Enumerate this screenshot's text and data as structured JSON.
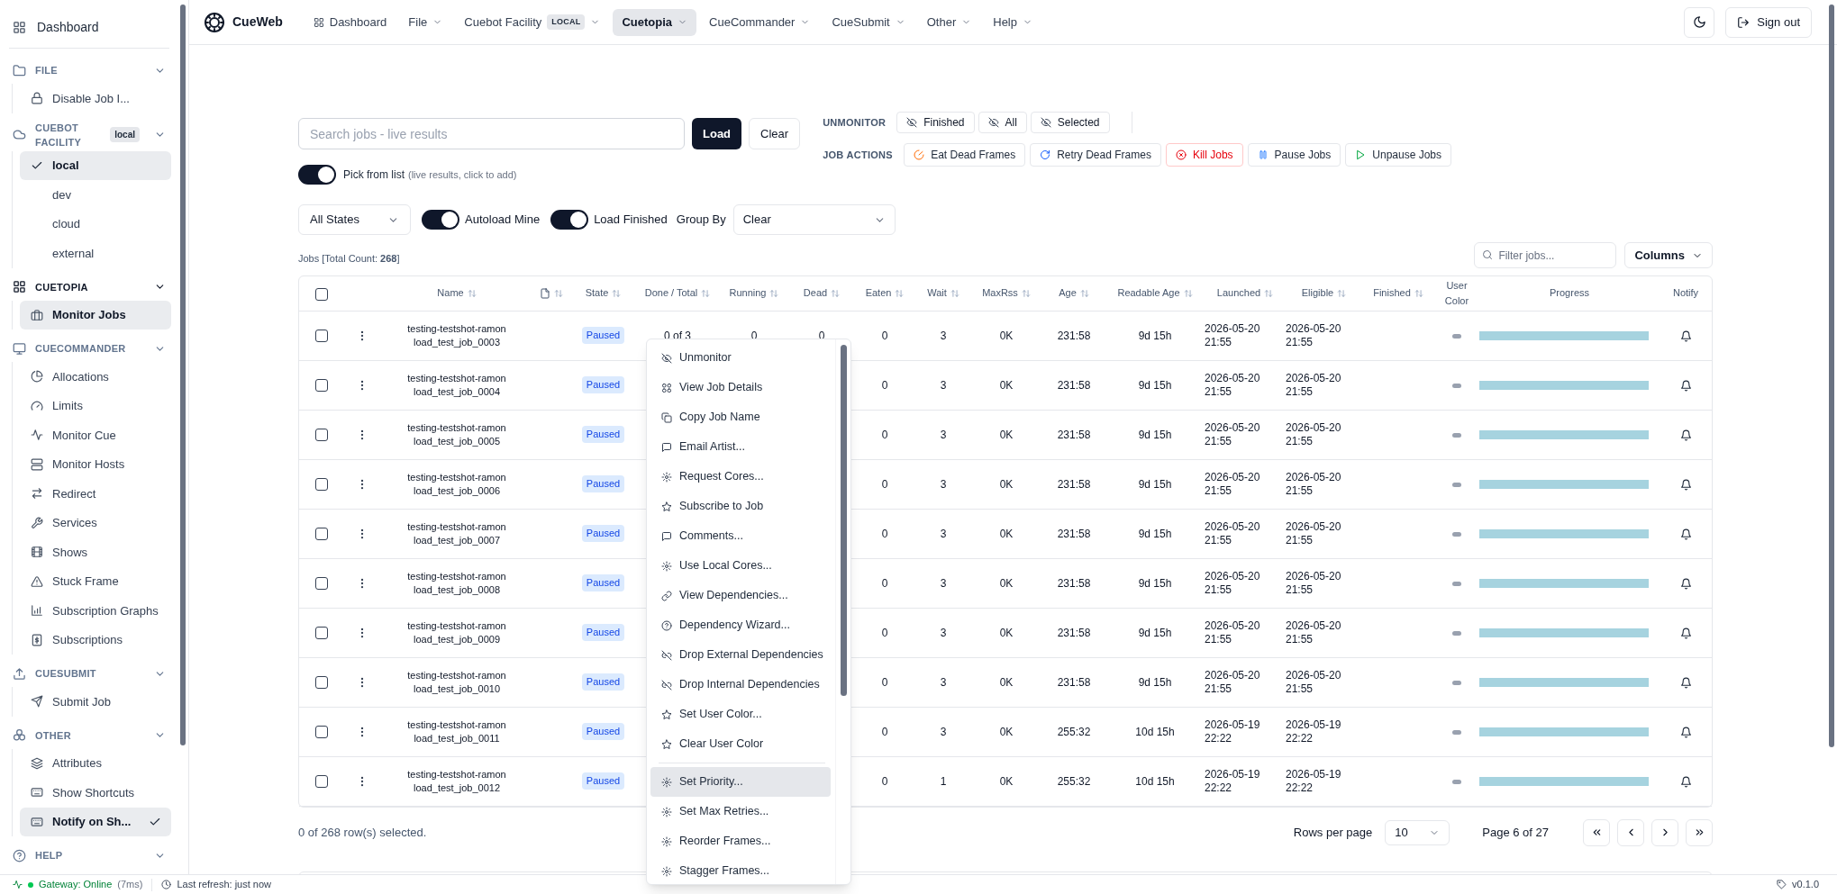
{
  "sidebar": {
    "dashboard": "Dashboard",
    "sections": [
      {
        "title": "FILE",
        "active": false,
        "items": [
          {
            "label": "Disable Job I...",
            "kind": "nav",
            "selected": false
          }
        ]
      },
      {
        "title": "CUEBOT FACILITY",
        "badge": "local",
        "active": false,
        "items": [
          {
            "label": "local",
            "kind": "radio",
            "selected": true,
            "checked": true
          },
          {
            "label": "dev",
            "kind": "radio",
            "selected": false,
            "checked": false
          },
          {
            "label": "cloud",
            "kind": "radio",
            "selected": false,
            "checked": false
          },
          {
            "label": "external",
            "kind": "radio",
            "selected": false,
            "checked": false
          }
        ]
      },
      {
        "title": "CUETOPIA",
        "active": true,
        "items": [
          {
            "label": "Monitor Jobs",
            "kind": "nav",
            "selected": true
          }
        ]
      },
      {
        "title": "CUECOMMANDER",
        "active": false,
        "items": [
          {
            "label": "Allocations",
            "kind": "nav",
            "selected": false
          },
          {
            "label": "Limits",
            "kind": "nav",
            "selected": false
          },
          {
            "label": "Monitor Cue",
            "kind": "nav",
            "selected": false
          },
          {
            "label": "Monitor Hosts",
            "kind": "nav",
            "selected": false
          },
          {
            "label": "Redirect",
            "kind": "nav",
            "selected": false
          },
          {
            "label": "Services",
            "kind": "nav",
            "selected": false
          },
          {
            "label": "Shows",
            "kind": "nav",
            "selected": false
          },
          {
            "label": "Stuck Frame",
            "kind": "nav",
            "selected": false
          },
          {
            "label": "Subscription Graphs",
            "kind": "nav",
            "selected": false
          },
          {
            "label": "Subscriptions",
            "kind": "nav",
            "selected": false
          }
        ]
      },
      {
        "title": "CUESUBMIT",
        "active": false,
        "items": [
          {
            "label": "Submit Job",
            "kind": "nav",
            "selected": false
          }
        ]
      },
      {
        "title": "OTHER",
        "active": false,
        "items": [
          {
            "label": "Attributes",
            "kind": "nav",
            "selected": false
          },
          {
            "label": "Show Shortcuts",
            "kind": "nav",
            "selected": false
          },
          {
            "label": "Notify on Sh...",
            "kind": "toggle",
            "selected": true,
            "checked": true
          }
        ]
      },
      {
        "title": "HELP",
        "active": false
      }
    ]
  },
  "nav": {
    "brand": "CueWeb",
    "items": [
      {
        "label": "Dashboard",
        "kind": "link",
        "selected": false
      },
      {
        "label": "File",
        "kind": "menu",
        "selected": false
      },
      {
        "label": "Cuebot Facility",
        "badge": "LOCAL",
        "kind": "menu",
        "selected": false
      },
      {
        "label": "Cuetopia",
        "kind": "menu",
        "selected": true
      },
      {
        "label": "CueCommander",
        "kind": "menu",
        "selected": false
      },
      {
        "label": "CueSubmit",
        "kind": "menu",
        "selected": false
      },
      {
        "label": "Other",
        "kind": "menu",
        "selected": false
      },
      {
        "label": "Help",
        "kind": "menu",
        "selected": false
      }
    ],
    "sign_out": "Sign out"
  },
  "search": {
    "placeholder": "Search jobs - live results",
    "load": "Load",
    "clear": "Clear",
    "pick": {
      "label": "Pick from list",
      "hint": "(live results, click to add)",
      "on": true
    }
  },
  "unmonitor": {
    "label": "UNMONITOR",
    "buttons": [
      "Finished",
      "All",
      "Selected"
    ]
  },
  "job_actions": {
    "label": "JOB ACTIONS",
    "buttons": [
      {
        "label": "Eat Dead Frames",
        "kind": "default"
      },
      {
        "label": "Retry Dead Frames",
        "kind": "default"
      },
      {
        "label": "Kill Jobs",
        "kind": "danger"
      },
      {
        "label": "Pause Jobs",
        "kind": "default"
      },
      {
        "label": "Unpause Jobs",
        "kind": "default"
      }
    ]
  },
  "filters": {
    "state": "All States",
    "toggles": [
      {
        "label": "Autoload Mine",
        "on": true
      },
      {
        "label": "Load Finished",
        "on": true
      }
    ],
    "group_by": {
      "label": "Group By",
      "value": "Clear"
    }
  },
  "jobs_count": "Jobs [Total Count: **268**]",
  "filter_placeholder": "Filter jobs...",
  "columns_button": "Columns",
  "table": {
    "all_checked": false,
    "columns": [
      {
        "label": "Name",
        "sortable": true
      },
      {
        "kind": "icon",
        "sortable": true
      },
      {
        "label": "State",
        "sortable": true
      },
      {
        "label": "Done / Total",
        "sortable": true
      },
      {
        "label": "Running",
        "sortable": true
      },
      {
        "label": "Dead",
        "sortable": true
      },
      {
        "label": "Eaten",
        "sortable": true
      },
      {
        "label": "Wait",
        "sortable": true
      },
      {
        "label": "MaxRss",
        "sortable": true
      },
      {
        "label": "Age",
        "sortable": true
      },
      {
        "label": "Readable Age",
        "sortable": true
      },
      {
        "label": "Launched",
        "sortable": true
      },
      {
        "label": "Eligible",
        "sortable": true
      },
      {
        "label": "Finished",
        "sortable": true
      },
      {
        "label": "User Color",
        "sortable": false
      },
      {
        "label": "Progress",
        "sortable": false
      },
      {
        "label": "Notify",
        "sortable": false
      }
    ],
    "rows": [
      {
        "checked": false,
        "name": [
          "testing-testshot-ramon",
          "load_test_job_0003"
        ],
        "state": "Paused",
        "done": "0 of 3",
        "running": "0",
        "dead": "0",
        "eaten": "0",
        "wait": "3",
        "maxrss": "0K",
        "age": "231:58",
        "readable_age": "9d 15h",
        "launched": "2026-05-20 21:55",
        "eligible": "2026-05-20 21:55",
        "level": 1
      },
      {
        "checked": false,
        "name": [
          "testing-testshot-ramon",
          "load_test_job_0004"
        ],
        "state": "Paused",
        "eaten": "0",
        "wait": "3",
        "maxrss": "0K",
        "age": "231:58",
        "readable_age": "9d 15h",
        "launched": "2026-05-20 21:55",
        "eligible": "2026-05-20 21:55",
        "level": 1
      },
      {
        "checked": false,
        "name": [
          "testing-testshot-ramon",
          "load_test_job_0005"
        ],
        "state": "Paused",
        "eaten": "0",
        "wait": "3",
        "maxrss": "0K",
        "age": "231:58",
        "readable_age": "9d 15h",
        "launched": "2026-05-20 21:55",
        "eligible": "2026-05-20 21:55",
        "level": 1
      },
      {
        "checked": false,
        "name": [
          "testing-testshot-ramon",
          "load_test_job_0006"
        ],
        "state": "Paused",
        "eaten": "0",
        "wait": "3",
        "maxrss": "0K",
        "age": "231:58",
        "readable_age": "9d 15h",
        "launched": "2026-05-20 21:55",
        "eligible": "2026-05-20 21:55",
        "level": 1
      },
      {
        "checked": false,
        "name": [
          "testing-testshot-ramon",
          "load_test_job_0007"
        ],
        "state": "Paused",
        "eaten": "0",
        "wait": "3",
        "maxrss": "0K",
        "age": "231:58",
        "readable_age": "9d 15h",
        "launched": "2026-05-20 21:55",
        "eligible": "2026-05-20 21:55",
        "level": 1
      },
      {
        "checked": false,
        "name": [
          "testing-testshot-ramon",
          "load_test_job_0008"
        ],
        "state": "Paused",
        "eaten": "0",
        "wait": "3",
        "maxrss": "0K",
        "age": "231:58",
        "readable_age": "9d 15h",
        "launched": "2026-05-20 21:55",
        "eligible": "2026-05-20 21:55",
        "level": 1
      },
      {
        "checked": false,
        "name": [
          "testing-testshot-ramon",
          "load_test_job_0009"
        ],
        "state": "Paused",
        "eaten": "0",
        "wait": "3",
        "maxrss": "0K",
        "age": "231:58",
        "readable_age": "9d 15h",
        "launched": "2026-05-20 21:55",
        "eligible": "2026-05-20 21:55",
        "level": 1
      },
      {
        "checked": false,
        "name": [
          "testing-testshot-ramon",
          "load_test_job_0010"
        ],
        "state": "Paused",
        "eaten": "0",
        "wait": "3",
        "maxrss": "0K",
        "age": "231:58",
        "readable_age": "9d 15h",
        "launched": "2026-05-20 21:55",
        "eligible": "2026-05-20 21:55",
        "level": 1
      },
      {
        "checked": false,
        "name": [
          "testing-testshot-ramon",
          "load_test_job_0011"
        ],
        "state": "Paused",
        "eaten": "0",
        "wait": "3",
        "maxrss": "0K",
        "age": "255:32",
        "readable_age": "10d 15h",
        "launched": "2026-05-19 22:22",
        "eligible": "2026-05-19 22:22",
        "level": 1
      },
      {
        "checked": false,
        "name": [
          "testing-testshot-ramon",
          "load_test_job_0012"
        ],
        "state": "Paused",
        "eaten": "0",
        "wait": "1",
        "maxrss": "0K",
        "age": "255:32",
        "readable_age": "10d 15h",
        "launched": "2026-05-19 22:22",
        "eligible": "2026-05-19 22:22",
        "level": 1
      }
    ]
  },
  "footer": {
    "selected": "0 of 268 row(s) selected.",
    "rows_per_page": "Rows per page",
    "page_size": "10",
    "page": "Page 6 of 27"
  },
  "context_menu": {
    "groups": [
      [
        {
          "label": "Unmonitor",
          "selected": false
        },
        {
          "label": "View Job Details",
          "selected": false
        },
        {
          "label": "Copy Job Name",
          "selected": false
        },
        {
          "label": "Email Artist...",
          "selected": false
        },
        {
          "label": "Request Cores...",
          "selected": false
        },
        {
          "label": "Subscribe to Job",
          "selected": false
        },
        {
          "label": "Comments...",
          "selected": false
        },
        {
          "label": "Use Local Cores...",
          "selected": false
        },
        {
          "label": "View Dependencies...",
          "selected": false
        },
        {
          "label": "Dependency Wizard...",
          "selected": false
        },
        {
          "label": "Drop External Dependencies",
          "selected": false
        },
        {
          "label": "Drop Internal Dependencies",
          "selected": false
        },
        {
          "label": "Set User Color...",
          "selected": false
        },
        {
          "label": "Clear User Color",
          "selected": false
        }
      ],
      [
        {
          "label": "Set Priority...",
          "selected": true
        },
        {
          "label": "Set Max Retries...",
          "selected": false
        },
        {
          "label": "Reorder Frames...",
          "selected": false
        },
        {
          "label": "Stagger Frames...",
          "selected": false
        }
      ]
    ]
  },
  "status_bar": {
    "gateway": "Gateway: Online",
    "online": true,
    "latency": "(7ms)",
    "refresh": "Last refresh: just now",
    "version": "v0.1.0"
  }
}
